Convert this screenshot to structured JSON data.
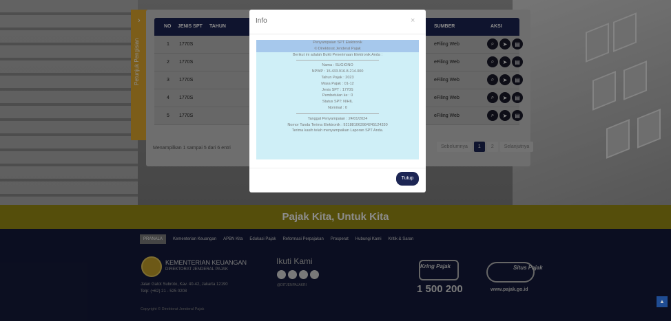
{
  "side_tab": {
    "label": "Petunjuk Pengisian",
    "arrow": "›"
  },
  "table": {
    "headers": [
      "NO",
      "JENIS SPT",
      "TAHUN",
      "SUMBER",
      "AKSI"
    ],
    "rows": [
      {
        "no": "1",
        "jenis": "1770S",
        "tahun": "2",
        "sumber": "eFiling Web"
      },
      {
        "no": "2",
        "jenis": "1770S",
        "tahun": "2",
        "sumber": "eFiling Web"
      },
      {
        "no": "3",
        "jenis": "1770S",
        "tahun": "2",
        "sumber": "eFiling Web"
      },
      {
        "no": "4",
        "jenis": "1770S",
        "tahun": "2",
        "sumber": "eFiling Web"
      },
      {
        "no": "5",
        "jenis": "1770S",
        "tahun": "2",
        "sumber": "eFiling Web"
      }
    ],
    "showing": "Menampilkan 1 sampai 5 dari 6 entri",
    "pager": {
      "prev": "Sebelumnya",
      "p1": "1",
      "p2": "2",
      "next": "Selanjutnya"
    }
  },
  "tagline": "Pajak Kita, Untuk Kita",
  "footer": {
    "nav": [
      "PRANALA",
      "Kementerian Keuangan",
      "APBN Kita",
      "Edukasi Pajak",
      "Reformasi Perpajakan",
      "Prosperat",
      "Hubungi Kami",
      "Kritik & Saran"
    ],
    "kemen_title": "KEMENTERIAN KEUANGAN",
    "kemen_sub": "DIREKTORAT JENDERAL PAJAK",
    "address": "Jalan Gatot Subroto, Kav. 40-42, Jakarta 12190",
    "phone_line": "Telp: (+62) 21 - 525 0208",
    "ikuti": "Ikuti Kami",
    "handle": "@DITJENPAJAKRI",
    "kring": "Kring Pajak",
    "kring_number": "1 500 200",
    "situs": "Situs Pajak",
    "site": "www.pajak.go.id",
    "copyright": "Copyright © Direktorat Jenderal Pajak"
  },
  "modal": {
    "title": "Info",
    "close": "×",
    "lines_header": [
      "Penyampaian SPT Elektronik",
      "© Direktorat Jenderal Pajak"
    ],
    "intro": "Berikut ini adalah Bukti Penerimaan Elektronik Anda :",
    "details": [
      "Nama : SUGIONO",
      "NPWP : 15.433.916.8-214.000",
      "Tahun Pajak : 2023",
      "Masa Pajak : 01-12",
      "Jenis SPT : 1770S",
      "Pembetulan ke : 0",
      "Status SPT: NIHIL",
      "Nominal : 0"
    ],
    "footer_lines": [
      "Tanggal Penyampaian : 24/01/2024",
      "Nomor Tanda Terima Elektronik : 921881063984245124330",
      "Terima kasih telah menyampaikan Laporan SPT Anda."
    ],
    "button": "Tutup"
  }
}
